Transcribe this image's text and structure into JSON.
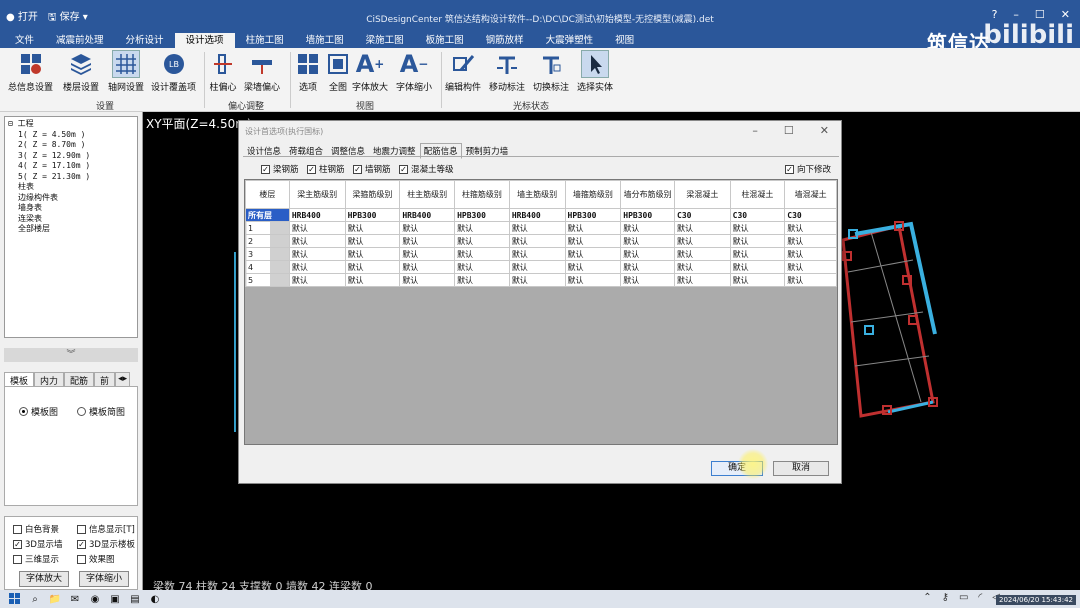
{
  "quick_access": {
    "open": "打开",
    "save": "保存"
  },
  "app_title": "CiSDesignCenter 筑信达结构设计软件--D:\\DC\\DC测试\\初始模型-无控模型(减震).det",
  "brand": "筑信达",
  "watermark": "bilibili",
  "menu": [
    "文件",
    "减震前处理",
    "分析设计",
    "设计选项",
    "柱施工图",
    "墙施工图",
    "梁施工图",
    "板施工图",
    "钢筋放样",
    "大震弹塑性",
    "视图"
  ],
  "menu_active_index": 3,
  "ribbon": {
    "buttons": [
      "总信息设置",
      "楼层设置",
      "轴网设置",
      "设计覆盖项",
      "柱偏心",
      "梁墙偏心",
      "选项",
      "全图",
      "字体放大",
      "字体缩小",
      "编辑构件",
      "移动标注",
      "切换标注",
      "选择实体"
    ],
    "groups": [
      "设置",
      "偏心调整",
      "视图",
      "光标状态"
    ]
  },
  "tree": {
    "root": "工程",
    "floors": [
      "1( Z = 4.50m )",
      "2( Z = 8.70m )",
      "3( Z = 12.90m )",
      "4( Z = 17.10m )",
      "5( Z = 21.30m )"
    ],
    "others": [
      "柱表",
      "边缘构件表",
      "墙身表",
      "连梁表",
      "全部楼层"
    ]
  },
  "panel_tabs": [
    "模板",
    "内力",
    "配筋",
    "前"
  ],
  "panel_radios": {
    "template_view": "模板图",
    "template_simple": "模板简图"
  },
  "display_options": {
    "white_bg": "白色背景",
    "info_display": "信息显示[T]",
    "wall_3d": "3D显示墙",
    "slab_3d": "3D显示楼板",
    "three_view": "三维显示",
    "effect": "效果图",
    "font_up": "字体放大",
    "font_down": "字体缩小"
  },
  "canvas": {
    "plane_label": "XY平面(Z=4.50m)",
    "status_text": "梁数 74  柱数 24  支撑数 0  墙数 42  连梁数 0"
  },
  "dialog": {
    "title": "设计首选项(执行国标)",
    "tabs": [
      "设计信息",
      "荷载组合",
      "调整信息",
      "地震力调整",
      "配筋信息",
      "预制剪力墙"
    ],
    "active_tab": 4,
    "filters": [
      "梁钢筋",
      "柱钢筋",
      "墙钢筋",
      "混凝土等级"
    ],
    "modify_down": "向下修改",
    "columns": [
      "楼层",
      "梁主筋级别",
      "梁箍筋级别",
      "柱主筋级别",
      "柱箍筋级别",
      "墙主筋级别",
      "墙箍筋级别",
      "墙分布筋级别",
      "梁混凝土",
      "柱混凝土",
      "墙混凝土"
    ],
    "rows": [
      [
        "所有层",
        "HRB400",
        "HPB300",
        "HRB400",
        "HPB300",
        "HRB400",
        "HPB300",
        "HPB300",
        "C30",
        "C30",
        "C30"
      ],
      [
        "1",
        "默认",
        "默认",
        "默认",
        "默认",
        "默认",
        "默认",
        "默认",
        "默认",
        "默认",
        "默认"
      ],
      [
        "2",
        "默认",
        "默认",
        "默认",
        "默认",
        "默认",
        "默认",
        "默认",
        "默认",
        "默认",
        "默认"
      ],
      [
        "3",
        "默认",
        "默认",
        "默认",
        "默认",
        "默认",
        "默认",
        "默认",
        "默认",
        "默认",
        "默认"
      ],
      [
        "4",
        "默认",
        "默认",
        "默认",
        "默认",
        "默认",
        "默认",
        "默认",
        "默认",
        "默认",
        "默认"
      ],
      [
        "5",
        "默认",
        "默认",
        "默认",
        "默认",
        "默认",
        "默认",
        "默认",
        "默认",
        "默认",
        "默认"
      ]
    ],
    "ok": "确定",
    "cancel": "取消"
  },
  "taskbar": {
    "clock": "2024/06/20 15:43:42"
  },
  "colors": {
    "accent": "#2b579a",
    "selected_row": "#2a5ec6",
    "wall_cyan": "#3ab0e0",
    "beam_red": "#c03030"
  }
}
